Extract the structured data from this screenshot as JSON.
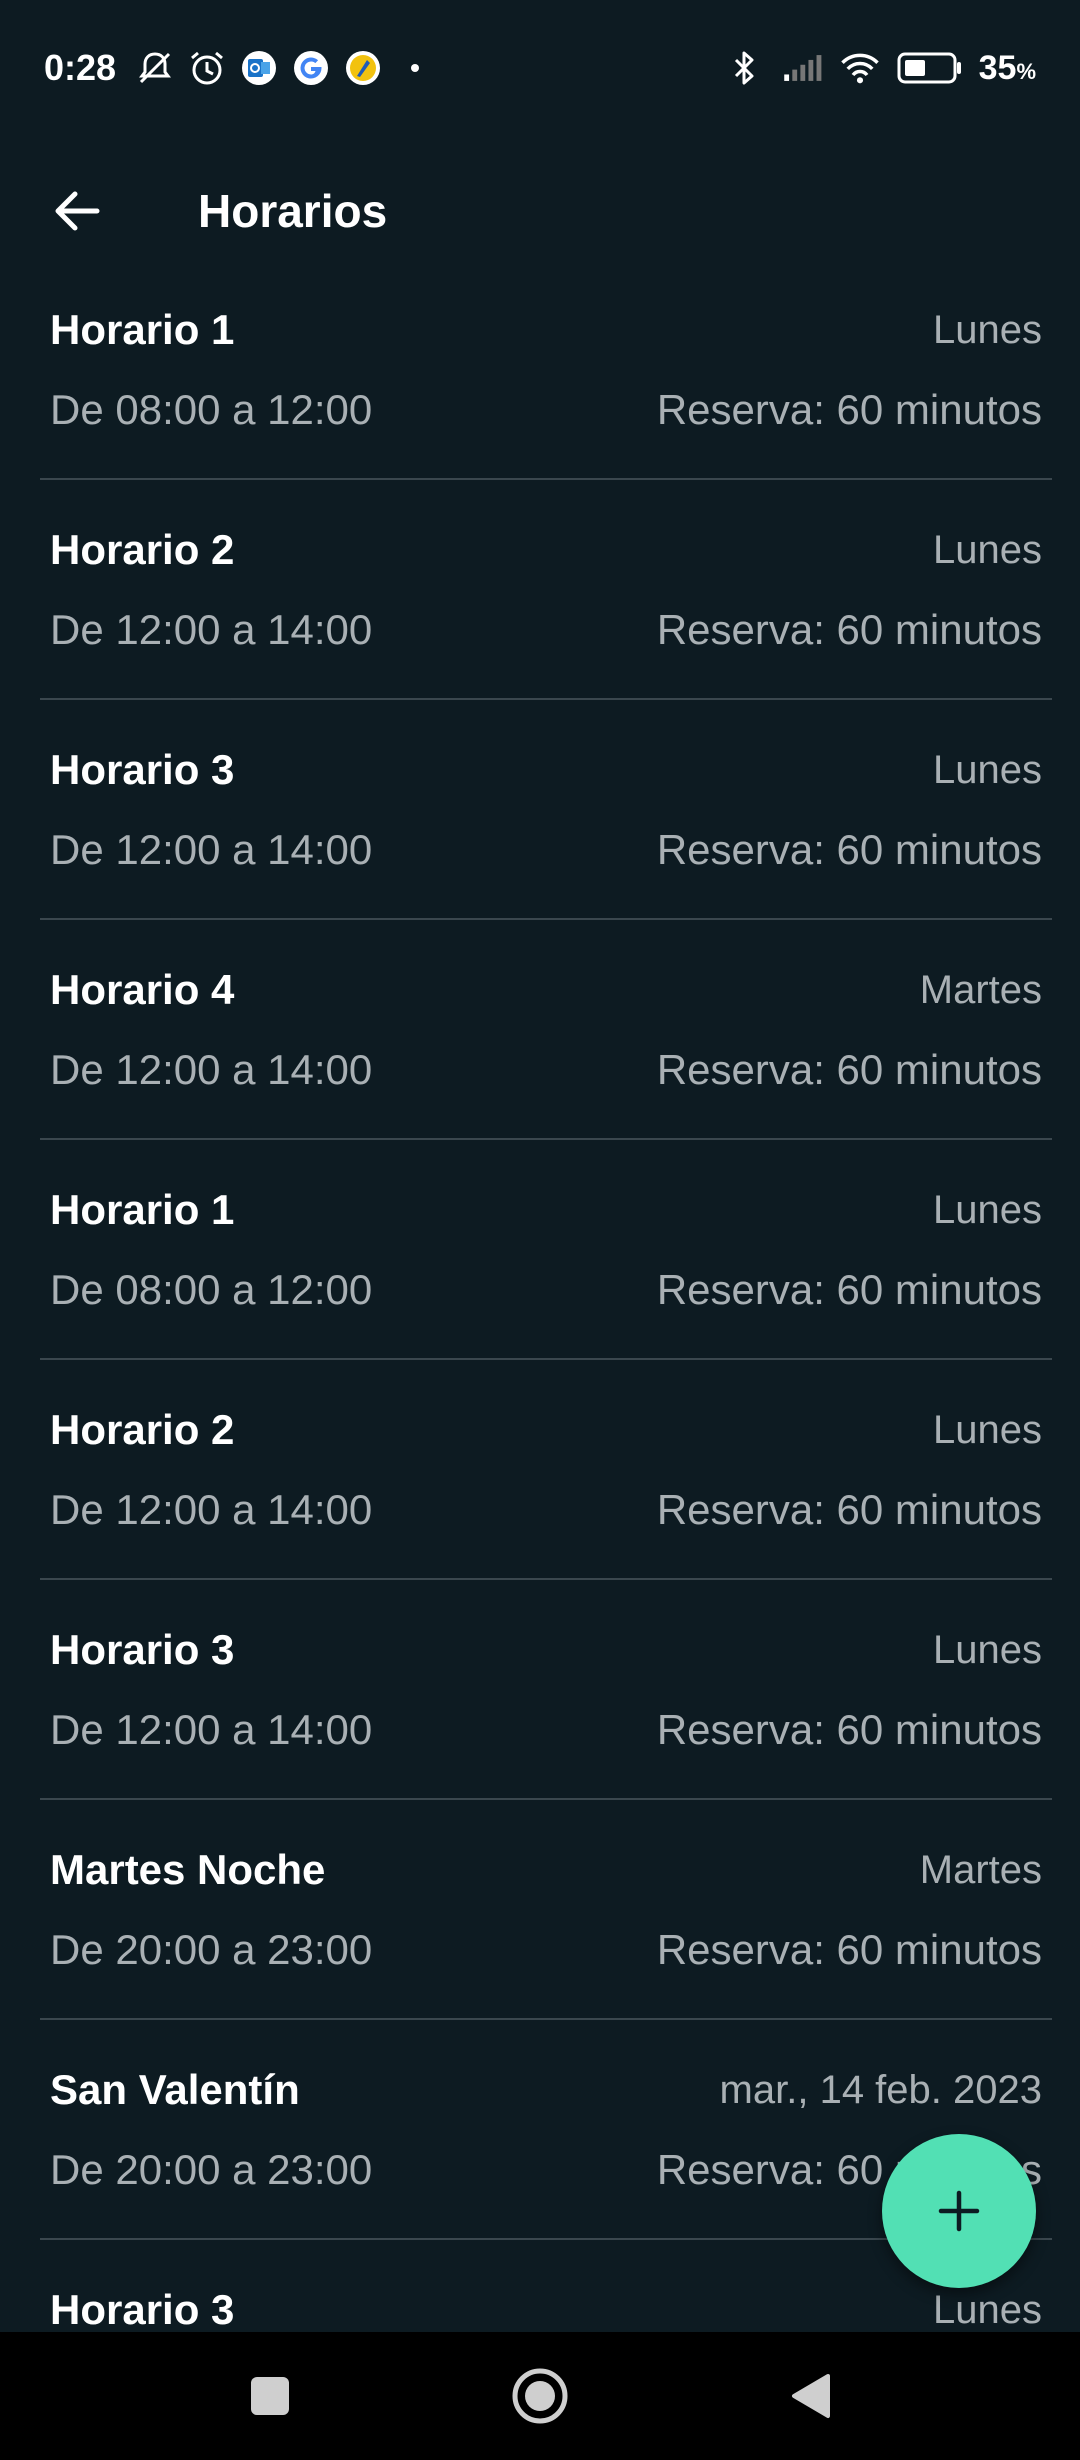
{
  "status_bar": {
    "time": "0:28",
    "battery_percent": "35",
    "battery_unit": "%",
    "icons": [
      "mute-icon",
      "alarm-icon",
      "outlook-icon",
      "google-icon",
      "app-icon",
      "dot-icon",
      "bluetooth-icon",
      "signal-icon",
      "wifi-icon",
      "battery-icon"
    ]
  },
  "app_bar": {
    "title": "Horarios",
    "back_icon": "arrow-left-icon"
  },
  "schedules": [
    {
      "name": "Horario 1",
      "day": "Lunes",
      "time": "De 08:00 a 12:00",
      "reserve": "Reserva: 60 minutos"
    },
    {
      "name": "Horario 2",
      "day": "Lunes",
      "time": "De 12:00 a 14:00",
      "reserve": "Reserva: 60 minutos"
    },
    {
      "name": "Horario 3",
      "day": "Lunes",
      "time": "De 12:00 a 14:00",
      "reserve": "Reserva: 60 minutos"
    },
    {
      "name": "Horario 4",
      "day": "Martes",
      "time": "De 12:00 a 14:00",
      "reserve": "Reserva: 60 minutos"
    },
    {
      "name": "Horario 1",
      "day": "Lunes",
      "time": "De 08:00 a 12:00",
      "reserve": "Reserva: 60 minutos"
    },
    {
      "name": "Horario 2",
      "day": "Lunes",
      "time": "De 12:00 a 14:00",
      "reserve": "Reserva: 60 minutos"
    },
    {
      "name": "Horario 3",
      "day": "Lunes",
      "time": "De 12:00 a 14:00",
      "reserve": "Reserva: 60 minutos"
    },
    {
      "name": "Martes Noche",
      "day": "Martes",
      "time": "De 20:00 a 23:00",
      "reserve": "Reserva: 60 minutos"
    },
    {
      "name": "San Valentín",
      "day": "mar., 14 feb. 2023",
      "time": "De 20:00 a 23:00",
      "reserve": "Reserva: 60 minutos"
    },
    {
      "name": "Horario 3",
      "day": "Lunes",
      "time": "",
      "reserve": ""
    }
  ],
  "fab": {
    "icon": "plus-icon",
    "color": "#52e0b4"
  },
  "nav_bar": {
    "buttons": [
      "recents-button",
      "home-button",
      "back-button"
    ]
  },
  "colors": {
    "background": "#0d1b22",
    "divider": "#3a474e",
    "secondary_text": "#a9b0b4",
    "accent": "#52e0b4"
  }
}
